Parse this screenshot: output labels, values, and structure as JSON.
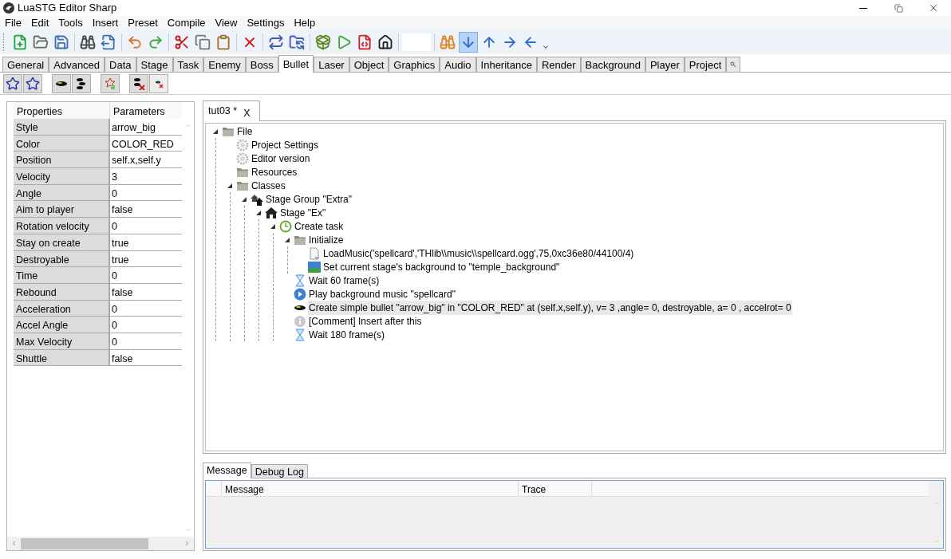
{
  "window": {
    "title": "LuaSTG Editor Sharp"
  },
  "menu": [
    "File",
    "Edit",
    "Tools",
    "Insert",
    "Preset",
    "Compile",
    "View",
    "Settings",
    "Help"
  ],
  "toolbar": [
    {
      "pressed": false
    },
    {
      "pressed": false
    },
    {
      "pressed": false
    },
    {
      "pressed": false
    },
    {
      "pressed": false
    },
    {
      "pressed": false
    },
    {
      "pressed": false
    },
    {
      "pressed": false
    },
    {
      "pressed": false
    },
    {
      "pressed": false
    },
    {
      "pressed": false
    },
    {
      "pressed": false
    },
    {
      "pressed": false
    },
    {
      "pressed": false
    },
    {
      "pressed": false
    },
    {
      "pressed": false
    },
    {
      "pressed": false
    },
    {
      "pressed": false
    },
    {
      "pressed": false
    },
    {
      "pressed": true
    },
    {
      "pressed": false
    },
    {
      "pressed": false
    },
    {
      "pressed": false
    }
  ],
  "node_tabs": [
    {
      "label": "General",
      "selected": false
    },
    {
      "label": "Advanced",
      "selected": false
    },
    {
      "label": "Data",
      "selected": false
    },
    {
      "label": "Stage",
      "selected": false
    },
    {
      "label": "Task",
      "selected": false
    },
    {
      "label": "Enemy",
      "selected": false
    },
    {
      "label": "Boss",
      "selected": false
    },
    {
      "label": "Bullet",
      "selected": true
    },
    {
      "label": "Laser",
      "selected": false
    },
    {
      "label": "Object",
      "selected": false
    },
    {
      "label": "Graphics",
      "selected": false
    },
    {
      "label": "Audio",
      "selected": false
    },
    {
      "label": "Inheritance",
      "selected": false
    },
    {
      "label": "Render",
      "selected": false
    },
    {
      "label": "Background",
      "selected": false
    },
    {
      "label": "Player",
      "selected": false
    },
    {
      "label": "Project",
      "selected": false
    }
  ],
  "properties": {
    "columns": [
      "Properties",
      "Parameters"
    ],
    "rows": [
      {
        "name": "Style",
        "value": "arrow_big"
      },
      {
        "name": "Color",
        "value": "COLOR_RED"
      },
      {
        "name": "Position",
        "value": "self.x,self.y"
      },
      {
        "name": "Velocity",
        "value": "3"
      },
      {
        "name": "Angle",
        "value": "0"
      },
      {
        "name": "Aim to player",
        "value": "false"
      },
      {
        "name": "Rotation velocity",
        "value": "0"
      },
      {
        "name": "Stay on create",
        "value": "true"
      },
      {
        "name": "Destroyable",
        "value": "true"
      },
      {
        "name": "Time",
        "value": "0"
      },
      {
        "name": "Rebound",
        "value": "false"
      },
      {
        "name": "Acceleration",
        "value": "0"
      },
      {
        "name": "Accel Angle",
        "value": "0"
      },
      {
        "name": "Max Velocity",
        "value": "0"
      },
      {
        "name": "Shuttle",
        "value": "false"
      }
    ]
  },
  "document_tab": {
    "title": "tut03 *",
    "close": "X"
  },
  "tree": [
    {
      "kind": "folder",
      "label": "File",
      "expanded": true,
      "selected": false,
      "children": [
        {
          "kind": "gear",
          "label": "Project Settings",
          "selected": false
        },
        {
          "kind": "gear",
          "label": "Editor version",
          "selected": false
        },
        {
          "kind": "folder",
          "label": "Resources",
          "selected": false
        },
        {
          "kind": "folder",
          "label": "Classes",
          "expanded": true,
          "selected": false,
          "children": [
            {
              "kind": "stagegroup",
              "label": "Stage Group \"Extra\"",
              "expanded": true,
              "selected": false,
              "children": [
                {
                  "kind": "stage",
                  "label": "Stage \"Ex\"",
                  "expanded": true,
                  "selected": false,
                  "children": [
                    {
                      "kind": "task",
                      "label": "Create task",
                      "expanded": true,
                      "selected": false,
                      "children": [
                        {
                          "kind": "folder",
                          "label": "Initialize",
                          "expanded": true,
                          "selected": false,
                          "children": [
                            {
                              "kind": "file",
                              "label": "LoadMusic('spellcard','THlib\\\\music\\\\spellcard.ogg',75,0xc36e80/44100/4)",
                              "selected": false
                            },
                            {
                              "kind": "image",
                              "label": "Set current stage's background to \"temple_background\"",
                              "selected": false
                            }
                          ]
                        },
                        {
                          "kind": "wait",
                          "label": "Wait 60 frame(s)",
                          "selected": false
                        },
                        {
                          "kind": "music",
                          "label": "Play background music \"spellcard\"",
                          "selected": false
                        },
                        {
                          "kind": "bullet",
                          "label": "Create simple bullet \"arrow_big\" in \"COLOR_RED\" at (self.x,self.y), v= 3 ,angle= 0, destroyable, a= 0 , accelrot= 0",
                          "selected": true
                        },
                        {
                          "kind": "comment",
                          "label": "[Comment] Insert after this",
                          "selected": false
                        },
                        {
                          "kind": "wait",
                          "label": "Wait 180 frame(s)",
                          "selected": false
                        }
                      ]
                    }
                  ]
                }
              ]
            }
          ]
        }
      ]
    }
  ],
  "bottom_tabs": [
    {
      "label": "Message",
      "selected": true
    },
    {
      "label": "Debug Log",
      "selected": false
    }
  ],
  "message_table": {
    "columns": [
      "Message",
      "Trace"
    ]
  }
}
